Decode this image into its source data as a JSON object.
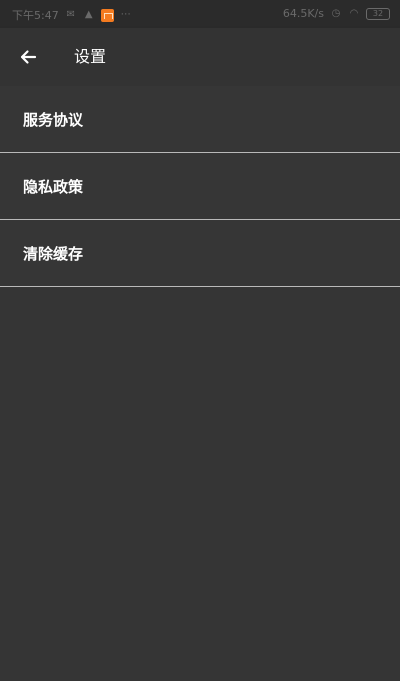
{
  "status_bar": {
    "time": "下午5:47",
    "network_speed": "64.5K/s",
    "battery": "32",
    "left_icons": [
      "wechat-icon",
      "warning-icon",
      "mi-app-icon",
      "more-dots-icon"
    ],
    "right_icons": [
      "alarm-icon",
      "wifi-icon",
      "battery-icon"
    ]
  },
  "header": {
    "title": "设置",
    "back_icon": "arrow-left-icon"
  },
  "settings": {
    "items": [
      {
        "label": "服务协议"
      },
      {
        "label": "隐私政策"
      },
      {
        "label": "清除缓存"
      }
    ]
  },
  "colors": {
    "background": "#353535",
    "status_bar": "#2b2b2b",
    "app_bar": "#333333",
    "divider": "#b9b9b9",
    "text": "#ffffff",
    "status_text": "#6a6a6a",
    "mi_orange": "#f47b20"
  }
}
